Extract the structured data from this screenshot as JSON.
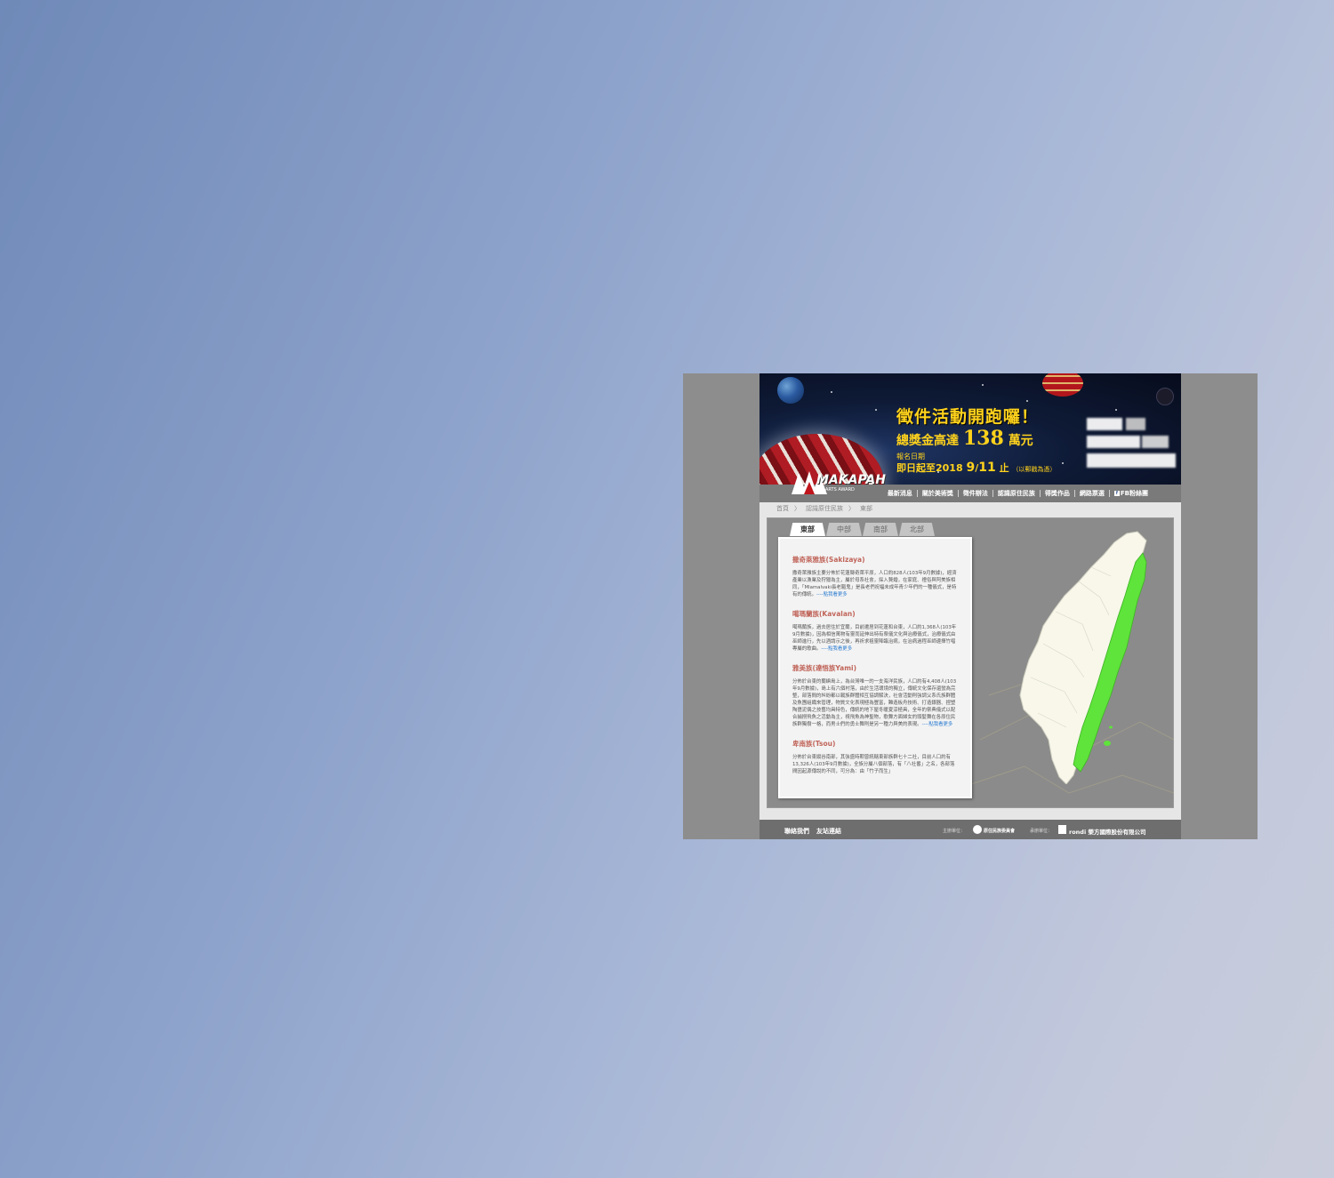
{
  "banner": {
    "title": "徵件活動開跑囉！",
    "prize_prefix": "總獎金高達",
    "prize_amount": "138",
    "prize_unit": "萬元",
    "date_label": "報名日期",
    "date_prefix": "即日起至2018",
    "date_month": "9",
    "date_sep": "/",
    "date_day": "11",
    "date_suffix": "止",
    "date_note": "（以郵戳為憑）",
    "logo_text": "MAKAPAH",
    "logo_sub": "ARTS AWARD"
  },
  "nav": {
    "items": [
      "最新消息",
      "關於美術獎",
      "徵件辦法",
      "認識原住民族",
      "得獎作品",
      "網路票選",
      "FB粉絲團"
    ]
  },
  "breadcrumb": [
    "首頁",
    "〉",
    "認識原住民族",
    "〉",
    "東部"
  ],
  "tabs": [
    "東部",
    "中部",
    "南部",
    "北部"
  ],
  "tribes": [
    {
      "name": "撒奇萊雅族(Sakizaya)",
      "desc": "撒奇萊雅族主要分佈於花蓮縣奇萊平原，人口約828人(103年9月數據)，經濟產業以漁業及狩獵為主，屬於母系社會，採入贅婚，在家庭、禮俗與阿美族相同，「Mlamalvaki長老驅鬼」是長老們祝福未成年青少年們的一種儀式，是特有的傳統。",
      "more": "----點我看更多"
    },
    {
      "name": "噶瑪蘭族(Kavalan)",
      "desc": "噶瑪蘭族，過去居住於宜蘭，目前遷居到花蓮和台東，人口約1,368人(103年9月數據)，因為相信萬物有靈而延伸出特有祭儀文化與治療儀式，治療儀式由巫師進行，先以酒請示之後，再祈求祖靈降臨治病，在治病過程巫師邊揮竹唱專屬的歌曲。",
      "more": "----點我看更多"
    },
    {
      "name": "雅美族(達悟族Yami)",
      "desc": "分佈於台東的蘭嶼島上，為台灣唯一的一支海洋民族，人口約有4,408人(103年9月數據)，島上有六個村落，由於生活環境的獨立，傳統文化保存還蠻為完整，部落間的糾紛都以戰族群體相互協調解決，社會活動則強調父系氏族群體及魚團組織來管理，物質文化表現極為豐富，難造板舟技術、打造銀器、捏塑陶甕泥偶之技藝均具特色，傳統的地下屋冬暖夏涼極具，全年的祭典儀式以配合捕撈飛魚之活動為主，視飛魚為神聖物，歌舞方面婦女的頭髮舞在各原住民族群獨樹一格，而男士們的勇士舞則是另一種力與美的表現。",
      "more": "----點我看更多"
    },
    {
      "name": "卑南族(Tsou)",
      "desc": "分佈於台東縱谷南部，其強盛時期曾統轄東部族群七十二社，目前人口約有13,326人(103年9月數據)，全族分屬八個部落，有「八社番」之名，各部落間因起源傳說的不同，可分為：由「竹子而生」",
      "more": ""
    }
  ],
  "footer": {
    "contact": "聯絡我們",
    "links": "友站連結",
    "host_label": "主辦單位：",
    "host_org": "原住民族委員會",
    "exec_label": "承辦單位：",
    "exec_org": "rondi 榮方國際股份有限公司"
  },
  "colors": {
    "highlight_region": "#5ee43a",
    "tribe_name": "#c0655a",
    "more_link": "#2a7bd0",
    "banner_text": "#ffd21c"
  }
}
